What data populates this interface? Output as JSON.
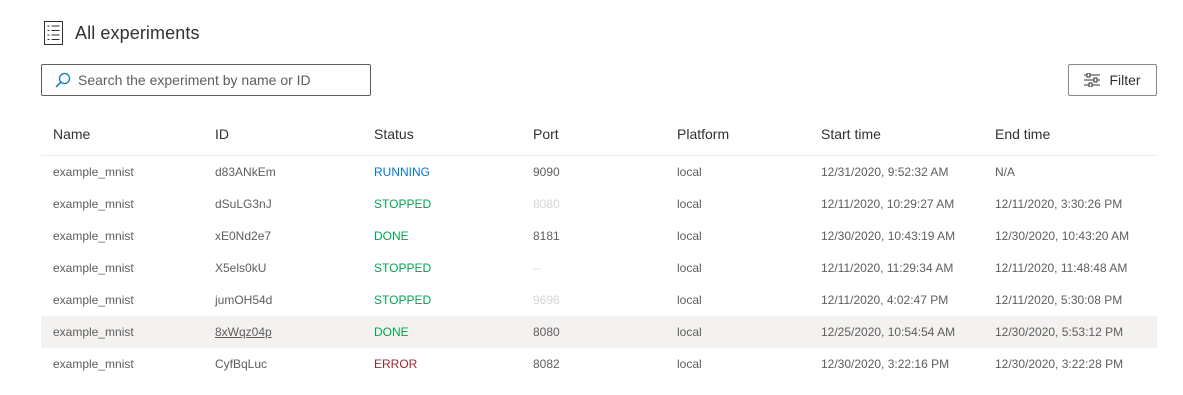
{
  "header": {
    "title": "All experiments",
    "icon": "list-document-icon"
  },
  "search": {
    "placeholder": "Search the experiment by name or ID",
    "value": ""
  },
  "filter": {
    "label": "Filter",
    "icon": "sliders-icon"
  },
  "colors": {
    "running": "#0078d4",
    "stopped": "#00a651",
    "done": "#00a651",
    "error": "#a4262c",
    "row_hover": "#f3f2f1"
  },
  "table": {
    "columns": [
      "Name",
      "ID",
      "Status",
      "Port",
      "Platform",
      "Start time",
      "End time"
    ],
    "rows": [
      {
        "name": "example_mnist",
        "id": "d83ANkEm",
        "status": "RUNNING",
        "port": "9090",
        "platform": "local",
        "start": "12/31/2020, 9:52:32 AM",
        "end": "N/A"
      },
      {
        "name": "example_mnist",
        "id": "dSuLG3nJ",
        "status": "STOPPED",
        "port": "8080",
        "platform": "local",
        "start": "12/11/2020, 10:29:27 AM",
        "end": "12/11/2020, 3:30:26 PM"
      },
      {
        "name": "example_mnist",
        "id": "xE0Nd2e7",
        "status": "DONE",
        "port": "8181",
        "platform": "local",
        "start": "12/30/2020, 10:43:19 AM",
        "end": "12/30/2020, 10:43:20 AM"
      },
      {
        "name": "example_mnist",
        "id": "X5els0kU",
        "status": "STOPPED",
        "port": "--",
        "platform": "local",
        "start": "12/11/2020, 11:29:34 AM",
        "end": "12/11/2020, 11:48:48 AM"
      },
      {
        "name": "example_mnist",
        "id": "jumOH54d",
        "status": "STOPPED",
        "port": "9696",
        "platform": "local",
        "start": "12/11/2020, 4:02:47 PM",
        "end": "12/11/2020, 5:30:08 PM"
      },
      {
        "name": "example_mnist",
        "id": "8xWqz04p",
        "status": "DONE",
        "port": "8080",
        "platform": "local",
        "start": "12/25/2020, 10:54:54 AM",
        "end": "12/30/2020, 5:53:12 PM"
      },
      {
        "name": "example_mnist",
        "id": "CyfBqLuc",
        "status": "ERROR",
        "port": "8082",
        "platform": "local",
        "start": "12/30/2020, 3:22:16 PM",
        "end": "12/30/2020, 3:22:28 PM"
      }
    ]
  }
}
